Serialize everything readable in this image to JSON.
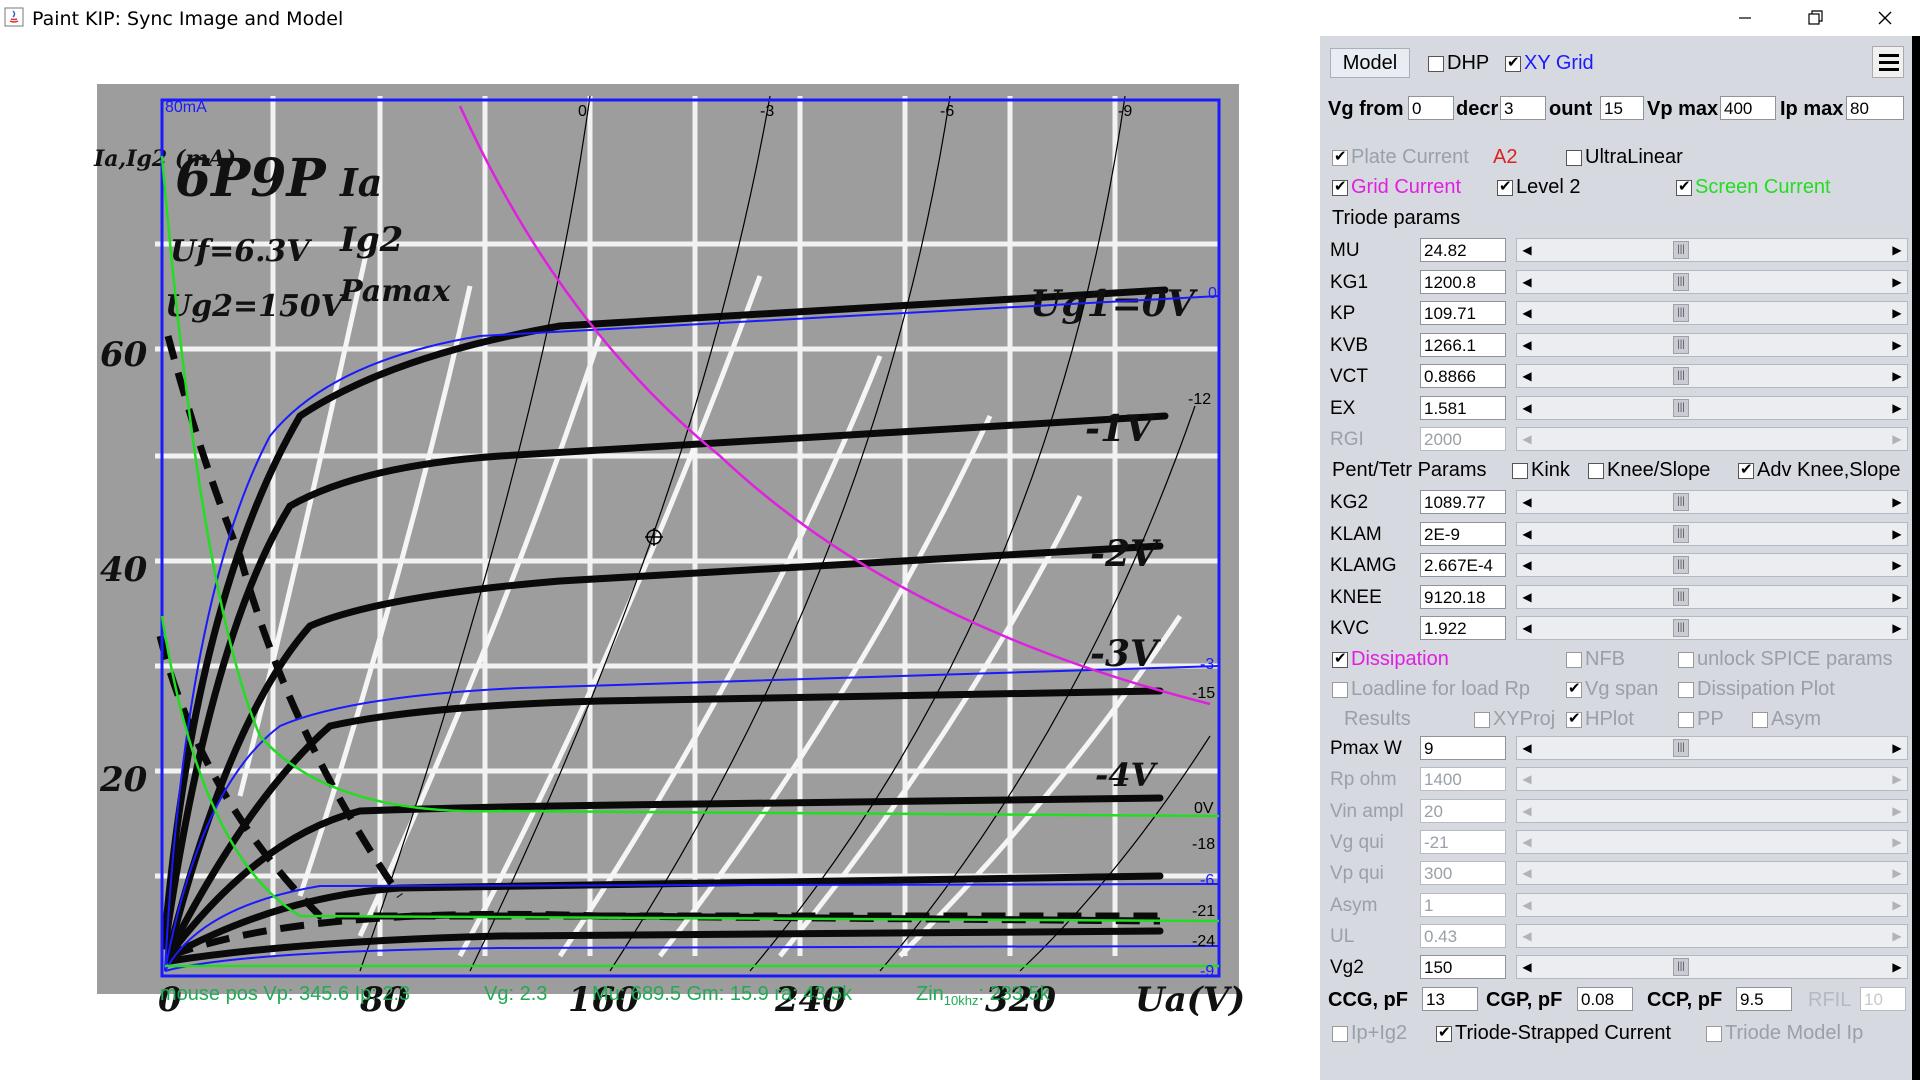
{
  "window": {
    "title": "Paint KIP: Sync Image and Model",
    "controls": [
      "minimize-icon",
      "restore-icon",
      "close-icon"
    ]
  },
  "plot": {
    "image_text": {
      "tube": "6P9P",
      "uf": "Uf=6.3V",
      "ug2": "Ug2=150V",
      "ia": "Ia",
      "ig2": "Ig2",
      "pamax": "Pamax",
      "ylabel": "Ia,Ig2 (mA)",
      "xlabel": "Ua(V)",
      "curve_labels": [
        "Ug1=0V",
        "-1V",
        "-2V",
        "-3V",
        "-4V"
      ]
    },
    "y_ticks": [
      "60",
      "40",
      "20"
    ],
    "x_ticks": [
      "0",
      "80",
      "160",
      "240",
      "320"
    ],
    "overlay_top_label": "80mA",
    "grid_top_labels": [
      "0",
      "-3",
      "-6",
      "-9"
    ],
    "grid_right_labels": [
      "0",
      "-12",
      "-3",
      "-15",
      "0V",
      "-18",
      "-6",
      "-21",
      "-24",
      "-9"
    ],
    "mouse_status": {
      "pos": "mouse pos Vp: 345.6   Ip: 2.3",
      "vg": "Vg: 2.3",
      "mu_gm_ra": "Mu: 689.5   Gm: 15.9    ra: 43.5k",
      "zin_label": "Zin",
      "zin_sub": "10khz",
      "zin_value": ": 233.5k"
    },
    "colors": {
      "model_grid": "#1a1aff",
      "grid_current": "#e020e0",
      "screen_current": "#22dd22",
      "status_text": "#22aa55"
    }
  },
  "panel": {
    "model_button": "Model",
    "dhp": {
      "label": "DHP",
      "checked": false
    },
    "xy_grid": {
      "label": "XY Grid",
      "checked": true
    },
    "vg_row": {
      "vg_from_label": "Vg from",
      "vg_from": "0",
      "decr_label": "decr",
      "decr": "3",
      "count_label": "ount",
      "count": "15",
      "vpmax_label": "Vp max",
      "vpmax": "400",
      "ipmax_label": "Ip max",
      "ipmax": "80"
    },
    "plate_current": {
      "label": "Plate Current",
      "checked": true,
      "tag": "A2"
    },
    "ultralinear": {
      "label": "UltraLinear",
      "checked": false
    },
    "grid_current": {
      "label": "Grid Current",
      "checked": true
    },
    "level2": {
      "label": "Level 2",
      "checked": true
    },
    "screen_current": {
      "label": "Screen Current",
      "checked": true
    },
    "triode_params_title": "Triode params",
    "triode_params": [
      {
        "name": "MU",
        "value": "24.82",
        "enabled": true
      },
      {
        "name": "KG1",
        "value": "1200.8",
        "enabled": true
      },
      {
        "name": "KP",
        "value": "109.71",
        "enabled": true
      },
      {
        "name": "KVB",
        "value": "1266.1",
        "enabled": true
      },
      {
        "name": "VCT",
        "value": "0.8866",
        "enabled": true
      },
      {
        "name": "EX",
        "value": "1.581",
        "enabled": true
      },
      {
        "name": "RGI",
        "value": "2000",
        "enabled": false
      }
    ],
    "pent_title": "Pent/Tetr Params",
    "kink": {
      "label": "Kink",
      "checked": false
    },
    "knee_slope": {
      "label": "Knee/Slope",
      "checked": false
    },
    "adv_knee": {
      "label": "Adv Knee,Slope",
      "checked": true
    },
    "pent_params": [
      {
        "name": "KG2",
        "value": "1089.77",
        "enabled": true
      },
      {
        "name": "KLAM",
        "value": "2E-9",
        "enabled": true
      },
      {
        "name": "KLAMG",
        "value": "2.667E-4",
        "enabled": true
      },
      {
        "name": "KNEE",
        "value": "9120.18",
        "enabled": true
      },
      {
        "name": "KVC",
        "value": "1.922",
        "enabled": true
      }
    ],
    "dissipation": {
      "label": "Dissipation",
      "checked": true
    },
    "nfb": {
      "label": "NFB",
      "checked": false
    },
    "unlock_spice": {
      "label": "unlock SPICE params",
      "checked": false
    },
    "loadline": {
      "label": "Loadline for load Rp",
      "checked": false
    },
    "vg_span": {
      "label": "Vg span",
      "checked": true
    },
    "dissipation_plot": {
      "label": "Dissipation Plot",
      "checked": false
    },
    "results_label": "Results",
    "xyproj": {
      "label": "XYProj",
      "checked": false
    },
    "hplot": {
      "label": "HPlot",
      "checked": true
    },
    "pp": {
      "label": "PP",
      "checked": false
    },
    "asym_cb": {
      "label": "Asym",
      "checked": false
    },
    "load_params": [
      {
        "name": "Pmax W",
        "value": "9",
        "enabled": true
      },
      {
        "name": "Rp ohm",
        "value": "1400",
        "enabled": false
      },
      {
        "name": "Vin ampl",
        "value": "20",
        "enabled": false
      },
      {
        "name": "Vg qui",
        "value": "-21",
        "enabled": false
      },
      {
        "name": "Vp qui",
        "value": "300",
        "enabled": false
      },
      {
        "name": "Asym",
        "value": "1",
        "enabled": false
      },
      {
        "name": "UL",
        "value": "0.43",
        "enabled": false
      },
      {
        "name": "Vg2",
        "value": "150",
        "enabled": true
      }
    ],
    "caps": {
      "ccg_label": "CCG, pF",
      "ccg": "13",
      "cgp_label": "CGP, pF",
      "cgp": "0.08",
      "ccp_label": "CCP, pF",
      "ccp": "9.5",
      "rfil_label": "RFIL",
      "rfil": "10"
    },
    "ip_ig2": {
      "label": "Ip+Ig2",
      "checked": false
    },
    "triode_strapped": {
      "label": "Triode-Strapped Current",
      "checked": true
    },
    "triode_model_ip": {
      "label": "Triode Model Ip",
      "checked": false
    }
  }
}
